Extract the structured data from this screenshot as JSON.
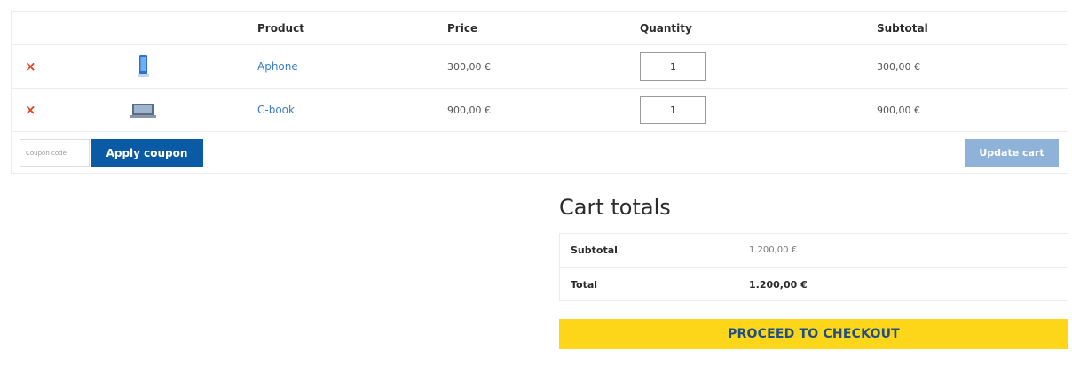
{
  "cart": {
    "headers": {
      "product": "Product",
      "price": "Price",
      "quantity": "Quantity",
      "subtotal": "Subtotal"
    },
    "items": [
      {
        "name": "Aphone",
        "price": "300,00 €",
        "quantity": "1",
        "subtotal": "300,00 €",
        "remove": "×",
        "thumb_icon": "phone-thumbnail"
      },
      {
        "name": "C-book",
        "price": "900,00 €",
        "quantity": "1",
        "subtotal": "900,00 €",
        "remove": "×",
        "thumb_icon": "laptop-thumbnail"
      }
    ],
    "coupon": {
      "placeholder": "Coupon code",
      "apply_label": "Apply coupon"
    },
    "update_label": "Update cart"
  },
  "totals": {
    "title": "Cart totals",
    "subtotal_label": "Subtotal",
    "subtotal_value": "1.200,00 €",
    "total_label": "Total",
    "total_value": "1.200,00 €",
    "checkout_label": "PROCEED TO CHECKOUT"
  },
  "colors": {
    "remove": "#e2401c",
    "link": "#3a7ec9",
    "apply_button": "#0b5aa6",
    "update_button": "#8fb3d8",
    "checkout_button": "#fdd61a",
    "checkout_text": "#1d4f86"
  }
}
